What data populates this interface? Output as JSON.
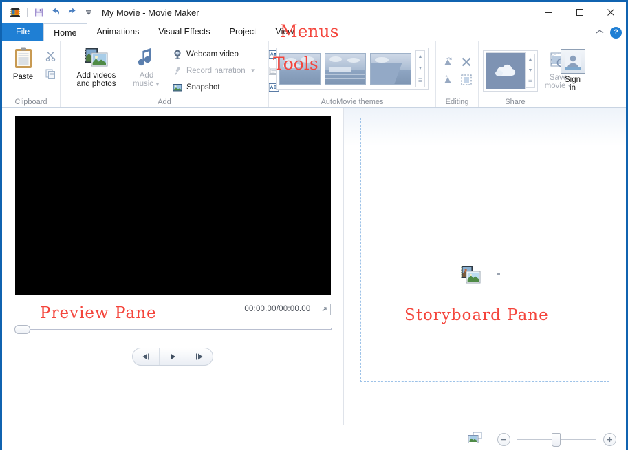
{
  "window": {
    "title": "My Movie - Movie Maker",
    "app_icon": "film-strip-icon",
    "quick_access": [
      {
        "name": "save-icon",
        "label": "Save"
      },
      {
        "name": "undo-icon",
        "label": "Undo"
      },
      {
        "name": "redo-icon",
        "label": "Redo"
      },
      {
        "name": "customize-qat-icon",
        "label": "Customize Quick Access Toolbar"
      }
    ],
    "controls": [
      {
        "name": "minimize-button",
        "glyph": "minimize-icon"
      },
      {
        "name": "maximize-button",
        "glyph": "maximize-icon"
      },
      {
        "name": "close-button",
        "glyph": "close-icon"
      }
    ]
  },
  "tabs": [
    {
      "label": "File",
      "active": false,
      "is_file": true
    },
    {
      "label": "Home",
      "active": true,
      "is_file": false
    },
    {
      "label": "Animations",
      "active": false,
      "is_file": false
    },
    {
      "label": "Visual Effects",
      "active": false,
      "is_file": false
    },
    {
      "label": "Project",
      "active": false,
      "is_file": false
    },
    {
      "label": "View",
      "active": false,
      "is_file": false
    }
  ],
  "tabstrip_right": {
    "collapse_ribbon": "chevron-up-icon",
    "help_label": "?"
  },
  "ribbon": {
    "clipboard": {
      "group_label": "Clipboard",
      "paste_label": "Paste",
      "cut_label": "Cut",
      "copy_label": "Copy"
    },
    "add": {
      "group_label": "Add",
      "add_videos_line1": "Add videos",
      "add_videos_line2": "and photos",
      "add_music_line1": "Add",
      "add_music_line2": "music",
      "webcam_video": "Webcam video",
      "record_narration": "Record narration",
      "snapshot": "Snapshot"
    },
    "text": {
      "title": "Title",
      "caption": "Caption",
      "credits": "Credits"
    },
    "automovie": {
      "group_label": "AutoMovie themes",
      "themes": [
        {
          "name": "theme-no-theme"
        },
        {
          "name": "theme-contemporary"
        },
        {
          "name": "theme-cinematic"
        }
      ],
      "scroll_up": "scroll-up-icon",
      "scroll_down": "scroll-down-icon",
      "more": "more-themes-icon"
    },
    "editing": {
      "group_label": "Editing",
      "items": [
        {
          "name": "rotate-left-icon"
        },
        {
          "name": "remove-icon"
        },
        {
          "name": "rotate-right-icon"
        },
        {
          "name": "select-all-icon"
        }
      ]
    },
    "share": {
      "group_label": "Share",
      "onedrive_name": "onedrive-thumbnail",
      "save_movie_line1": "Save",
      "save_movie_line2": "movie",
      "signin_line1": "Sign",
      "signin_line2": "in"
    }
  },
  "preview": {
    "timecode": "00:00.00/00:00.00",
    "expand_label": "Expand to full screen",
    "transport": [
      {
        "name": "previous-frame-button"
      },
      {
        "name": "play-button"
      },
      {
        "name": "next-frame-button"
      }
    ]
  },
  "storyboard": {
    "drop_icon": "add-media-icon"
  },
  "statusbar": {
    "thumbnail_size_icon": "thumbnail-size-icon",
    "zoom_out_label": "−",
    "zoom_in_label": "+"
  },
  "annotations": [
    {
      "text": "Menus",
      "name": "annotation-menus"
    },
    {
      "text": "Tools",
      "name": "annotation-tools"
    },
    {
      "text": "Preview Pane",
      "name": "annotation-preview-pane"
    },
    {
      "text": "Storyboard Pane",
      "name": "annotation-storyboard-pane"
    }
  ],
  "colors": {
    "accent": "#1f7fd4",
    "annotation_red": "#f4453c",
    "window_border": "#1063b0",
    "video_black": "#000000"
  }
}
